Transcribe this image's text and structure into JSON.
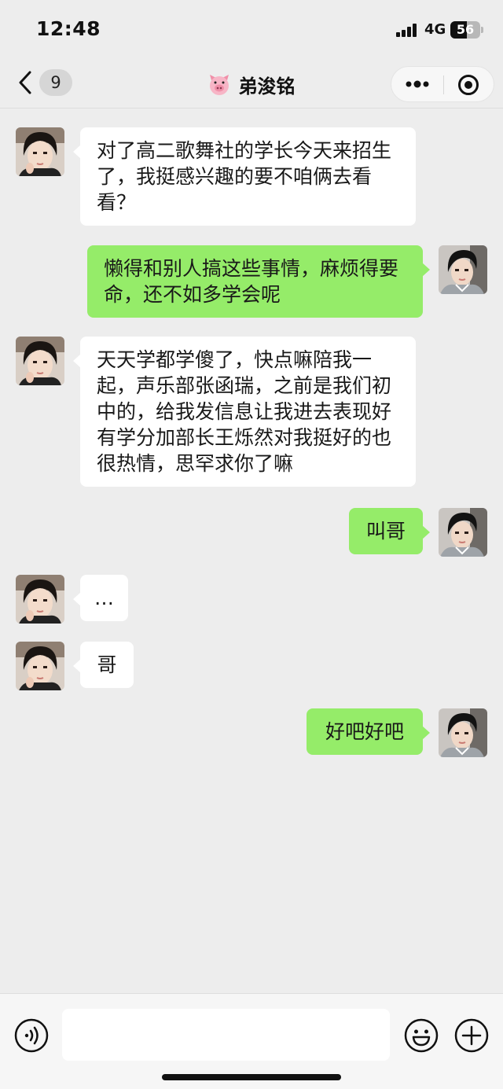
{
  "status_bar": {
    "time": "12:48",
    "network": "4G",
    "battery": "56",
    "battery_level": 0.56
  },
  "header": {
    "back_icon": "chevron-left-icon",
    "unread_count": "9",
    "title_emoji": "pig-face-icon",
    "title": "弟浚铭",
    "more_icon": "more-dots-icon",
    "close_icon": "target-circle-icon"
  },
  "messages": [
    {
      "side": "in",
      "text": "对了高二歌舞社的学长今天来招生了，我挺感兴趣的要不咱俩去看看？"
    },
    {
      "side": "out",
      "text": "懒得和别人搞这些事情，麻烦得要命，还不如多学会呢"
    },
    {
      "side": "in",
      "text": "天天学都学傻了，快点嘛陪我一起，声乐部张函瑞，之前是我们初中的，给我发信息让我进去表现好有学分加部长王烁然对我挺好的也很热情，思罕求你了嘛"
    },
    {
      "side": "out",
      "text": "叫哥"
    },
    {
      "side": "in",
      "text": "…"
    },
    {
      "side": "in",
      "text": "哥"
    },
    {
      "side": "out",
      "text": "好吧好吧"
    }
  ],
  "input_bar": {
    "voice_icon": "voice-icon",
    "input_value": "",
    "emoji_icon": "emoji-icon",
    "plus_icon": "plus-icon"
  },
  "colors": {
    "background": "#ededed",
    "outgoing_bubble": "#95ec69",
    "incoming_bubble": "#ffffff"
  }
}
